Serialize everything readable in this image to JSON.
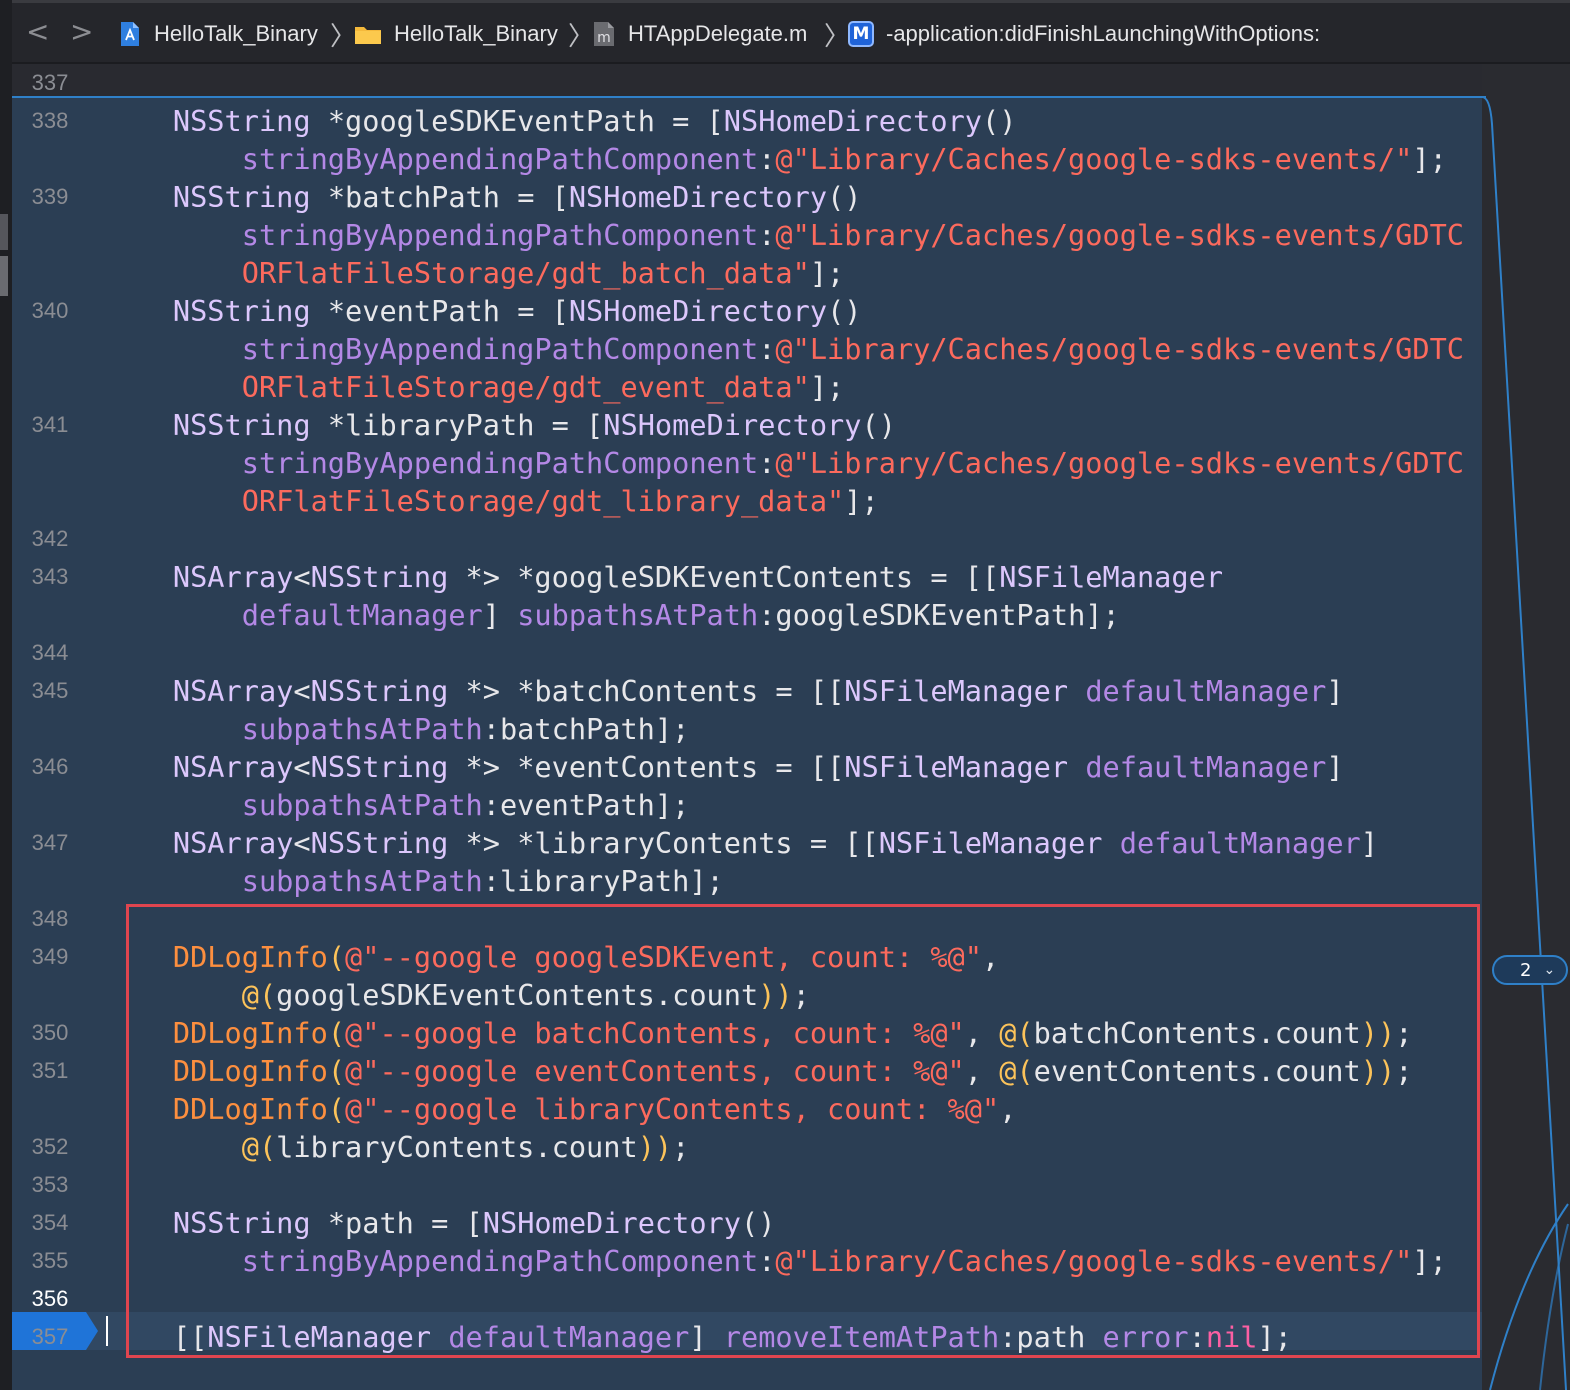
{
  "breadcrumb": {
    "nav_back": "<",
    "nav_forward": ">",
    "items": [
      {
        "icon": "xcode-project-icon",
        "label": "HelloTalk_Binary"
      },
      {
        "icon": "folder-icon",
        "label": "HelloTalk_Binary"
      },
      {
        "icon": "m-file-icon",
        "label": "HTAppDelegate.m"
      },
      {
        "icon": "method-icon",
        "label": "-application:didFinishLaunchingWithOptions:"
      }
    ],
    "method_icon_letter": "M",
    "file_icon_letter": "m"
  },
  "editor": {
    "line_numbers": [
      "337",
      "338",
      "339",
      "340",
      "341",
      "342",
      "343",
      "344",
      "345",
      "346",
      "347",
      "348",
      "349",
      "350",
      "351",
      "352",
      "353",
      "354",
      "355",
      "356",
      "357"
    ],
    "current_line": "356",
    "change_badge": "2",
    "code_lines": [
      [
        [
          "p",
          "    "
        ],
        [
          "t",
          "NSString"
        ],
        [
          "p",
          " *googleSDKEventPath = ["
        ],
        [
          "t",
          "NSHomeDirectory"
        ],
        [
          "p",
          "()"
        ]
      ],
      [
        [
          "p",
          "        "
        ],
        [
          "m",
          "stringByAppendingPathComponent"
        ],
        [
          "p",
          ":"
        ],
        [
          "s",
          "@\"Library/Caches/google-sdks-events/\""
        ],
        [
          "p",
          "];"
        ]
      ],
      [
        [
          "p",
          "    "
        ],
        [
          "t",
          "NSString"
        ],
        [
          "p",
          " *batchPath = ["
        ],
        [
          "t",
          "NSHomeDirectory"
        ],
        [
          "p",
          "()"
        ]
      ],
      [
        [
          "p",
          "        "
        ],
        [
          "m",
          "stringByAppendingPathComponent"
        ],
        [
          "p",
          ":"
        ],
        [
          "s",
          "@\"Library/Caches/google-sdks-events/GDTC"
        ]
      ],
      [
        [
          "p",
          "        "
        ],
        [
          "s",
          "ORFlatFileStorage/gdt_batch_data\""
        ],
        [
          "p",
          "];"
        ]
      ],
      [
        [
          "p",
          "    "
        ],
        [
          "t",
          "NSString"
        ],
        [
          "p",
          " *eventPath = ["
        ],
        [
          "t",
          "NSHomeDirectory"
        ],
        [
          "p",
          "()"
        ]
      ],
      [
        [
          "p",
          "        "
        ],
        [
          "m",
          "stringByAppendingPathComponent"
        ],
        [
          "p",
          ":"
        ],
        [
          "s",
          "@\"Library/Caches/google-sdks-events/GDTC"
        ]
      ],
      [
        [
          "p",
          "        "
        ],
        [
          "s",
          "ORFlatFileStorage/gdt_event_data\""
        ],
        [
          "p",
          "];"
        ]
      ],
      [
        [
          "p",
          "    "
        ],
        [
          "t",
          "NSString"
        ],
        [
          "p",
          " *libraryPath = ["
        ],
        [
          "t",
          "NSHomeDirectory"
        ],
        [
          "p",
          "()"
        ]
      ],
      [
        [
          "p",
          "        "
        ],
        [
          "m",
          "stringByAppendingPathComponent"
        ],
        [
          "p",
          ":"
        ],
        [
          "s",
          "@\"Library/Caches/google-sdks-events/GDTC"
        ]
      ],
      [
        [
          "p",
          "        "
        ],
        [
          "s",
          "ORFlatFileStorage/gdt_library_data\""
        ],
        [
          "p",
          "];"
        ]
      ],
      [
        [
          "p",
          "    "
        ],
        [
          "t",
          "NSArray"
        ],
        [
          "p",
          "<"
        ],
        [
          "t",
          "NSString"
        ],
        [
          "p",
          " *> *googleSDKEventContents = [["
        ],
        [
          "t",
          "NSFileManager"
        ]
      ],
      [
        [
          "p",
          "        "
        ],
        [
          "m",
          "defaultManager"
        ],
        [
          "p",
          "] "
        ],
        [
          "m",
          "subpathsAtPath"
        ],
        [
          "p",
          ":googleSDKEventPath];"
        ]
      ],
      [
        [
          "p",
          "    "
        ],
        [
          "t",
          "NSArray"
        ],
        [
          "p",
          "<"
        ],
        [
          "t",
          "NSString"
        ],
        [
          "p",
          " *> *batchContents = [["
        ],
        [
          "t",
          "NSFileManager"
        ],
        [
          "p",
          " "
        ],
        [
          "m",
          "defaultManager"
        ],
        [
          "p",
          "]"
        ]
      ],
      [
        [
          "p",
          "        "
        ],
        [
          "m",
          "subpathsAtPath"
        ],
        [
          "p",
          ":batchPath];"
        ]
      ],
      [
        [
          "p",
          "    "
        ],
        [
          "t",
          "NSArray"
        ],
        [
          "p",
          "<"
        ],
        [
          "t",
          "NSString"
        ],
        [
          "p",
          " *> *eventContents = [["
        ],
        [
          "t",
          "NSFileManager"
        ],
        [
          "p",
          " "
        ],
        [
          "m",
          "defaultManager"
        ],
        [
          "p",
          "]"
        ]
      ],
      [
        [
          "p",
          "        "
        ],
        [
          "m",
          "subpathsAtPath"
        ],
        [
          "p",
          ":eventPath];"
        ]
      ],
      [
        [
          "p",
          "    "
        ],
        [
          "t",
          "NSArray"
        ],
        [
          "p",
          "<"
        ],
        [
          "t",
          "NSString"
        ],
        [
          "p",
          " *> *libraryContents = [["
        ],
        [
          "t",
          "NSFileManager"
        ],
        [
          "p",
          " "
        ],
        [
          "m",
          "defaultManager"
        ],
        [
          "p",
          "]"
        ]
      ],
      [
        [
          "p",
          "        "
        ],
        [
          "m",
          "subpathsAtPath"
        ],
        [
          "p",
          ":libraryPath];"
        ]
      ],
      [
        [
          "p",
          "    "
        ],
        [
          "f",
          "DDLogInfo"
        ],
        [
          "y",
          "("
        ],
        [
          "s",
          "@\"--google googleSDKEvent, count: %@\""
        ],
        [
          "p",
          ","
        ]
      ],
      [
        [
          "p",
          "        "
        ],
        [
          "y",
          "@("
        ],
        [
          "p",
          "googleSDKEventContents.count"
        ],
        [
          "y",
          ")"
        ],
        [
          "y",
          ")"
        ],
        [
          "p",
          ";"
        ]
      ],
      [
        [
          "p",
          "    "
        ],
        [
          "f",
          "DDLogInfo"
        ],
        [
          "y",
          "("
        ],
        [
          "s",
          "@\"--google batchContents, count: %@\""
        ],
        [
          "p",
          ", "
        ],
        [
          "y",
          "@("
        ],
        [
          "p",
          "batchContents.count"
        ],
        [
          "y",
          "))"
        ],
        [
          "p",
          ";"
        ]
      ],
      [
        [
          "p",
          "    "
        ],
        [
          "f",
          "DDLogInfo"
        ],
        [
          "y",
          "("
        ],
        [
          "s",
          "@\"--google eventContents, count: %@\""
        ],
        [
          "p",
          ", "
        ],
        [
          "y",
          "@("
        ],
        [
          "p",
          "eventContents.count"
        ],
        [
          "y",
          "))"
        ],
        [
          "p",
          ";"
        ]
      ],
      [
        [
          "p",
          "    "
        ],
        [
          "f",
          "DDLogInfo"
        ],
        [
          "y",
          "("
        ],
        [
          "s",
          "@\"--google libraryContents, count: %@\""
        ],
        [
          "p",
          ","
        ]
      ],
      [
        [
          "p",
          "        "
        ],
        [
          "y",
          "@("
        ],
        [
          "p",
          "libraryContents.count"
        ],
        [
          "y",
          "))"
        ],
        [
          "p",
          ";"
        ]
      ],
      [
        [
          "p",
          "    "
        ],
        [
          "t",
          "NSString"
        ],
        [
          "p",
          " *path = ["
        ],
        [
          "t",
          "NSHomeDirectory"
        ],
        [
          "p",
          "()"
        ]
      ],
      [
        [
          "p",
          "        "
        ],
        [
          "m",
          "stringByAppendingPathComponent"
        ],
        [
          "p",
          ":"
        ],
        [
          "s",
          "@\"Library/Caches/google-sdks-events/\""
        ],
        [
          "p",
          "];"
        ]
      ],
      [
        [
          "p",
          "    [["
        ],
        [
          "t",
          "NSFileManager"
        ],
        [
          "p",
          " "
        ],
        [
          "m",
          "defaultManager"
        ],
        [
          "p",
          "] "
        ],
        [
          "m",
          "removeItemAtPath"
        ],
        [
          "p",
          ":path "
        ],
        [
          "m",
          "error"
        ],
        [
          "p",
          ":"
        ],
        [
          "k",
          "nil"
        ],
        [
          "p",
          "];"
        ]
      ]
    ]
  }
}
